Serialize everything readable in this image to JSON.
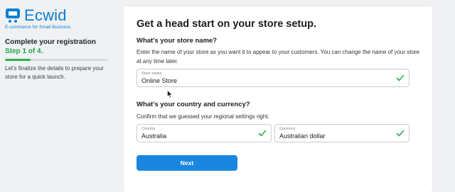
{
  "brand": {
    "name": "Ecwid",
    "tagline": "E-commerce for Small Business",
    "color": "#0a7fd1"
  },
  "sidebar": {
    "title": "Complete your registration",
    "step": "Step 1 of 4.",
    "progress_fraction": 0.25,
    "description": "Let's finalize the details to prepare your store for a quick launch."
  },
  "card": {
    "title": "Get a head start on your store setup."
  },
  "store_section": {
    "title": "What's your store name?",
    "description": "Enter the name of your store as you want it to appear to your customers. You can change the name of your store at any time later.",
    "field_label": "Store name",
    "field_value": "Online Store"
  },
  "country_section": {
    "title": "What's your country and currency?",
    "description": "Confirm that we guessed your regional settings right.",
    "country_label": "Country",
    "country_value": "Australia",
    "currency_label": "Currency",
    "currency_value": "Australian dollar"
  },
  "actions": {
    "next_label": "Next"
  },
  "colors": {
    "accent": "#1a86e0",
    "success": "#27b14c",
    "background": "#f0f1f3"
  },
  "icons": {
    "logo": "shopping-cart-icon",
    "valid": "check-icon",
    "pointer": "mouse-cursor-icon"
  }
}
